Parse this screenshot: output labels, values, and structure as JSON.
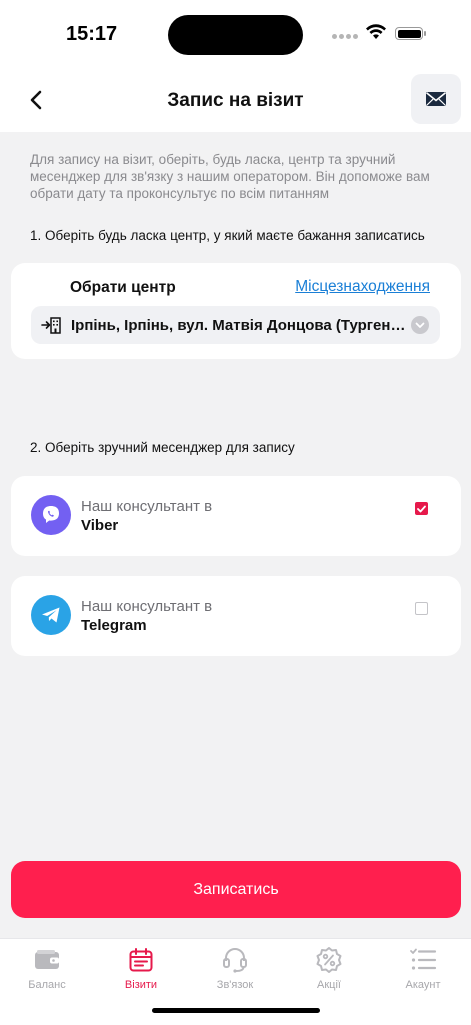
{
  "status": {
    "time": "15:17"
  },
  "header": {
    "title": "Запис на візит",
    "back_icon": "chevron-left-icon",
    "mail_icon": "envelope-icon"
  },
  "intro_text": "Для запису на візит, оберіть, будь ласка, центр та зручний месенджер для зв'язку з нашим оператором. Він допоможе вам обрати дату та проконсультує по всім питанням",
  "step1": "1. Оберіть будь ласка центр, у який маєте бажання записатись",
  "center": {
    "label": "Обрати центр",
    "location_link": "Місцезнаходження",
    "selected": "Ірпінь, Ірпінь, вул. Матвія Донцова (Тургенівська)"
  },
  "step2": "2. Оберіть зручний месенджер для запису",
  "messengers": [
    {
      "line1": "Наш консультант в",
      "name": "Viber",
      "checked": true,
      "color": "#7360f2"
    },
    {
      "line1": "Наш консультант в",
      "name": "Telegram",
      "checked": false,
      "color": "#2aa3e6"
    }
  ],
  "submit_label": "Записатись",
  "tabs": [
    {
      "label": "Баланс",
      "icon": "wallet-icon",
      "active": false
    },
    {
      "label": "Візити",
      "icon": "calendar-icon",
      "active": true
    },
    {
      "label": "Зв'язок",
      "icon": "headset-icon",
      "active": false
    },
    {
      "label": "Акції",
      "icon": "percent-badge-icon",
      "active": false
    },
    {
      "label": "Акаунт",
      "icon": "list-icon",
      "active": false
    }
  ],
  "colors": {
    "accent": "#ff1f4e",
    "active_tab": "#e6194b",
    "link": "#1a7fd6"
  }
}
